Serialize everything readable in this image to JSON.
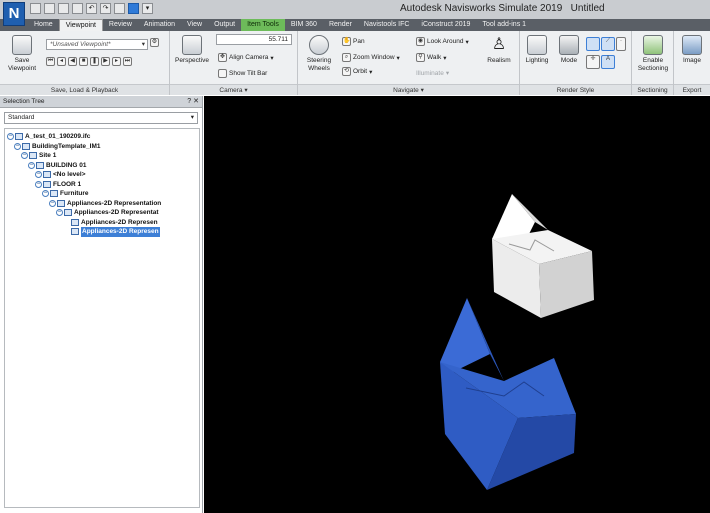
{
  "window": {
    "title": "Autodesk Navisworks Simulate 2019",
    "doc": "Untitled"
  },
  "app_logo": "N",
  "tabs": [
    {
      "label": "Home"
    },
    {
      "label": "Viewpoint"
    },
    {
      "label": "Review"
    },
    {
      "label": "Animation"
    },
    {
      "label": "View"
    },
    {
      "label": "Output"
    },
    {
      "label": "Item Tools"
    },
    {
      "label": "BIM 360"
    },
    {
      "label": "Render"
    },
    {
      "label": "Navistools IFC"
    },
    {
      "label": "iConstruct 2019"
    },
    {
      "label": "Tool add-ins 1"
    }
  ],
  "active_tab": "Viewpoint",
  "context_tab": "Item Tools",
  "ribbon": {
    "save_viewpoint": "Save Viewpoint",
    "viewpoint_combo": "*Unsaved Viewpoint*",
    "group_save": "Save, Load & Playback",
    "perspective": "Perspective",
    "fov_value": "55.711",
    "align_camera": "Align Camera",
    "show_tilt_bar": "Show Tilt Bar",
    "group_camera": "Camera",
    "steering_wheels": "Steering Wheels",
    "pan": "Pan",
    "zoom_window": "Zoom Window",
    "orbit": "Orbit",
    "look_around": "Look Around",
    "walk": "Walk",
    "illuminate": "Illuminate",
    "realism": "Realism",
    "group_navigate": "Navigate",
    "lighting": "Lighting",
    "mode": "Mode",
    "group_render_style": "Render Style",
    "enable_sectioning": "Enable Sectioning",
    "group_sectioning": "Sectioning",
    "image": "Image",
    "group_export": "Export"
  },
  "panel": {
    "title": "Selection Tree",
    "controls": "? ✕",
    "dropdown": "Standard",
    "tree": [
      {
        "label": "A_test_01_190209.ifc",
        "depth": 0
      },
      {
        "label": "BuildingTemplate_IM1",
        "depth": 1
      },
      {
        "label": "Site 1",
        "depth": 2
      },
      {
        "label": "BUILDING 01",
        "depth": 3
      },
      {
        "label": "<No level>",
        "depth": 4
      },
      {
        "label": "FLOOR 1",
        "depth": 4
      },
      {
        "label": "Furniture",
        "depth": 5
      },
      {
        "label": "Appliances-2D Representation",
        "depth": 6
      },
      {
        "label": "Appliances-2D Representat",
        "depth": 7
      },
      {
        "label": "Appliances-2D Represen",
        "depth": 8
      },
      {
        "label": "Appliances-2D Represen",
        "depth": 8
      }
    ]
  },
  "colors": {
    "viewport_bg": "#000000",
    "blue_object": "#2f5fc8",
    "white_object": "#eeeeee",
    "accent": "#3d7fd6"
  },
  "icons": [
    "save-viewpoint-icon",
    "perspective-icon",
    "steering-wheels-icon",
    "pan-icon",
    "zoom-window-icon",
    "orbit-icon",
    "look-around-icon",
    "walk-icon",
    "realism-icon",
    "lighting-icon",
    "mode-icon",
    "enable-sectioning-icon",
    "image-icon"
  ]
}
